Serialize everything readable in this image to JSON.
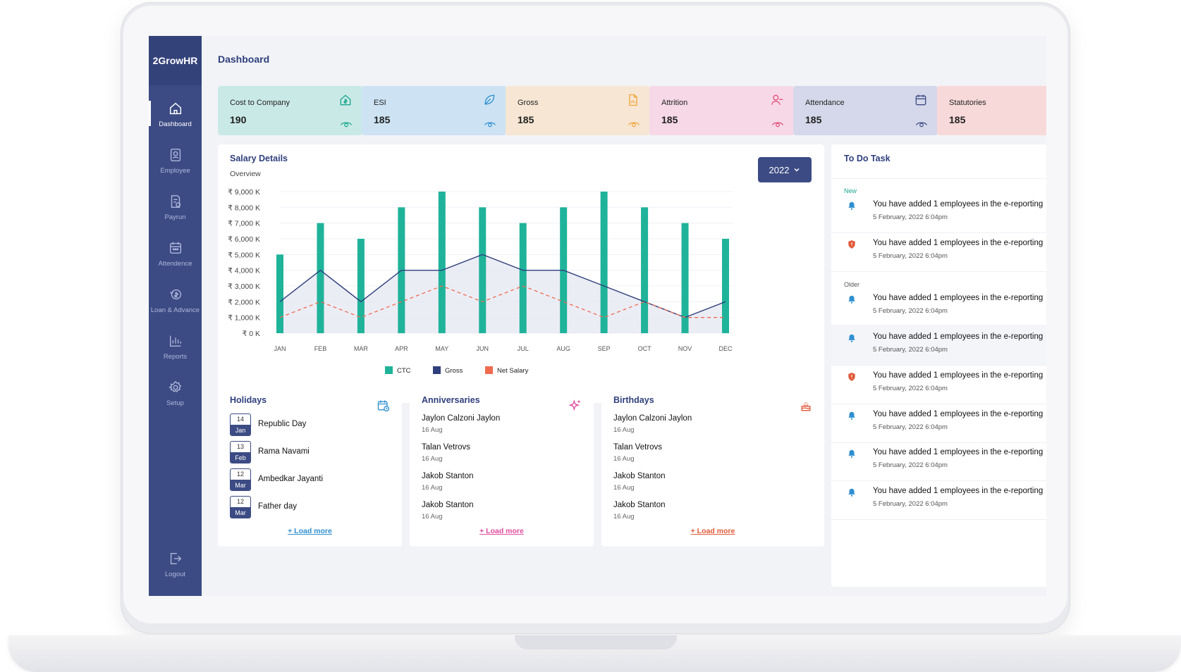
{
  "app": {
    "logo": "2GrowHR",
    "page_title": "Dashboard"
  },
  "sidebar": {
    "items": [
      {
        "label": "Dashboard",
        "icon": "home-icon"
      },
      {
        "label": "Employee",
        "icon": "user-card-icon"
      },
      {
        "label": "Payrun",
        "icon": "payroll-icon"
      },
      {
        "label": "Attendence",
        "icon": "calendar-icon"
      },
      {
        "label": "Loan & Advance",
        "icon": "loan-icon"
      },
      {
        "label": "Reports",
        "icon": "bar-chart-icon"
      },
      {
        "label": "Setup",
        "icon": "gear-icon"
      }
    ],
    "logout": "Logout"
  },
  "stats": [
    {
      "label": "Cost to Company",
      "value": "190",
      "bg": "#c9e9e6",
      "accent": "#1aa68e",
      "icon": "money-house-icon"
    },
    {
      "label": "ESI",
      "value": "185",
      "bg": "#cde3f3",
      "accent": "#2f8fd0",
      "icon": "leaf-icon"
    },
    {
      "label": "Gross",
      "value": "185",
      "bg": "#f6e6d3",
      "accent": "#f0a53a",
      "icon": "document-icon"
    },
    {
      "label": "Attrition",
      "value": "185",
      "bg": "#f6d8e6",
      "accent": "#e04d79",
      "icon": "user-minus-icon"
    },
    {
      "label": "Attendance",
      "value": "185",
      "bg": "#d5d8ea",
      "accent": "#3c4b84",
      "icon": "calendar-icon"
    },
    {
      "label": "Statutories",
      "value": "185",
      "bg": "#f8d9da",
      "accent": "#e05a5a",
      "icon": "shield-icon"
    }
  ],
  "salary": {
    "title": "Salary Details",
    "subtitle": "Overview",
    "year": "2022"
  },
  "chart_data": {
    "type": "bar",
    "categories": [
      "JAN",
      "FEB",
      "MAR",
      "APR",
      "MAY",
      "JUN",
      "JUL",
      "AUG",
      "SEP",
      "OCT",
      "NOV",
      "DEC"
    ],
    "y_ticks": [
      "₹ 9,000 K",
      "₹ 8,000 K",
      "₹ 7,000 K",
      "₹ 6,000 K",
      "₹ 5,000 K",
      "₹ 4,000 K",
      "₹ 3,000 K",
      "₹ 2,000 K",
      "₹ 1,000 K",
      "₹ 0 K"
    ],
    "ylim": [
      0,
      9000
    ],
    "series": [
      {
        "name": "CTC",
        "type": "bar",
        "color": "#1fb39a",
        "values": [
          5000,
          7000,
          6000,
          8000,
          9000,
          8000,
          7000,
          8000,
          9000,
          8000,
          7000,
          6000
        ]
      },
      {
        "name": "Gross",
        "type": "line",
        "color": "#2f3f7c",
        "values": [
          2000,
          4000,
          2000,
          4000,
          4000,
          5000,
          4000,
          4000,
          3000,
          2000,
          1000,
          2000
        ]
      },
      {
        "name": "Net Salary",
        "type": "dashed-line",
        "color": "#f06b4f",
        "values": [
          1000,
          2000,
          1000,
          2000,
          3000,
          2000,
          3000,
          2000,
          1000,
          2000,
          1000,
          1000
        ]
      }
    ],
    "legend": "bottom"
  },
  "todo": {
    "title": "To Do Task",
    "new_label": "New",
    "older_label": "Older",
    "items": [
      {
        "text": "You have added 1 employees in the e-reporting",
        "date": "5 February, 2022 6:04pm",
        "icon": "bell-icon"
      },
      {
        "text": "You have added 1 employees in the e-reporting",
        "date": "5 February, 2022 6:04pm",
        "icon": "alert-shield-icon"
      },
      {
        "text": "You have added 1 employees in the e-reporting",
        "date": "5 February, 2022 6:04pm",
        "icon": "bell-icon"
      },
      {
        "text": "You have added 1 employees in the e-reporting",
        "date": "5 February, 2022 6:04pm",
        "icon": "bell-icon"
      },
      {
        "text": "You have added 1 employees in the e-reporting",
        "date": "5 February, 2022 6:04pm",
        "icon": "alert-shield-icon"
      },
      {
        "text": "You have added 1 employees in the e-reporting",
        "date": "5 February, 2022 6:04pm",
        "icon": "bell-icon"
      },
      {
        "text": "You have added 1 employees in the e-reporting",
        "date": "5 February, 2022 6:04pm",
        "icon": "bell-icon"
      },
      {
        "text": "You have added 1 employees in the e-reporting",
        "date": "5 February, 2022 6:04pm",
        "icon": "bell-icon"
      }
    ]
  },
  "holidays": {
    "title": "Holidays",
    "load_more": "+ Load more",
    "items": [
      {
        "day": "14",
        "month": "Jan",
        "name": "Republic Day"
      },
      {
        "day": "13",
        "month": "Feb",
        "name": "Rama Navami"
      },
      {
        "day": "12",
        "month": "Mar",
        "name": "Ambedkar Jayanti"
      },
      {
        "day": "12",
        "month": "Mar",
        "name": "Father day"
      }
    ]
  },
  "anniversaries": {
    "title": "Anniversaries",
    "load_more": "+ Load more",
    "items": [
      {
        "name": "Jaylon Calzoni Jaylon",
        "date": "16 Aug"
      },
      {
        "name": "Talan Vetrovs",
        "date": "16 Aug"
      },
      {
        "name": "Jakob Stanton",
        "date": "16 Aug"
      },
      {
        "name": "Jakob Stanton",
        "date": "16 Aug"
      }
    ]
  },
  "birthdays": {
    "title": "Birthdays",
    "load_more": "+ Load more",
    "items": [
      {
        "name": "Jaylon Calzoni Jaylon",
        "date": "16 Aug"
      },
      {
        "name": "Talan Vetrovs",
        "date": "16 Aug"
      },
      {
        "name": "Jakob Stanton",
        "date": "16 Aug"
      },
      {
        "name": "Jakob Stanton",
        "date": "16 Aug"
      }
    ]
  }
}
